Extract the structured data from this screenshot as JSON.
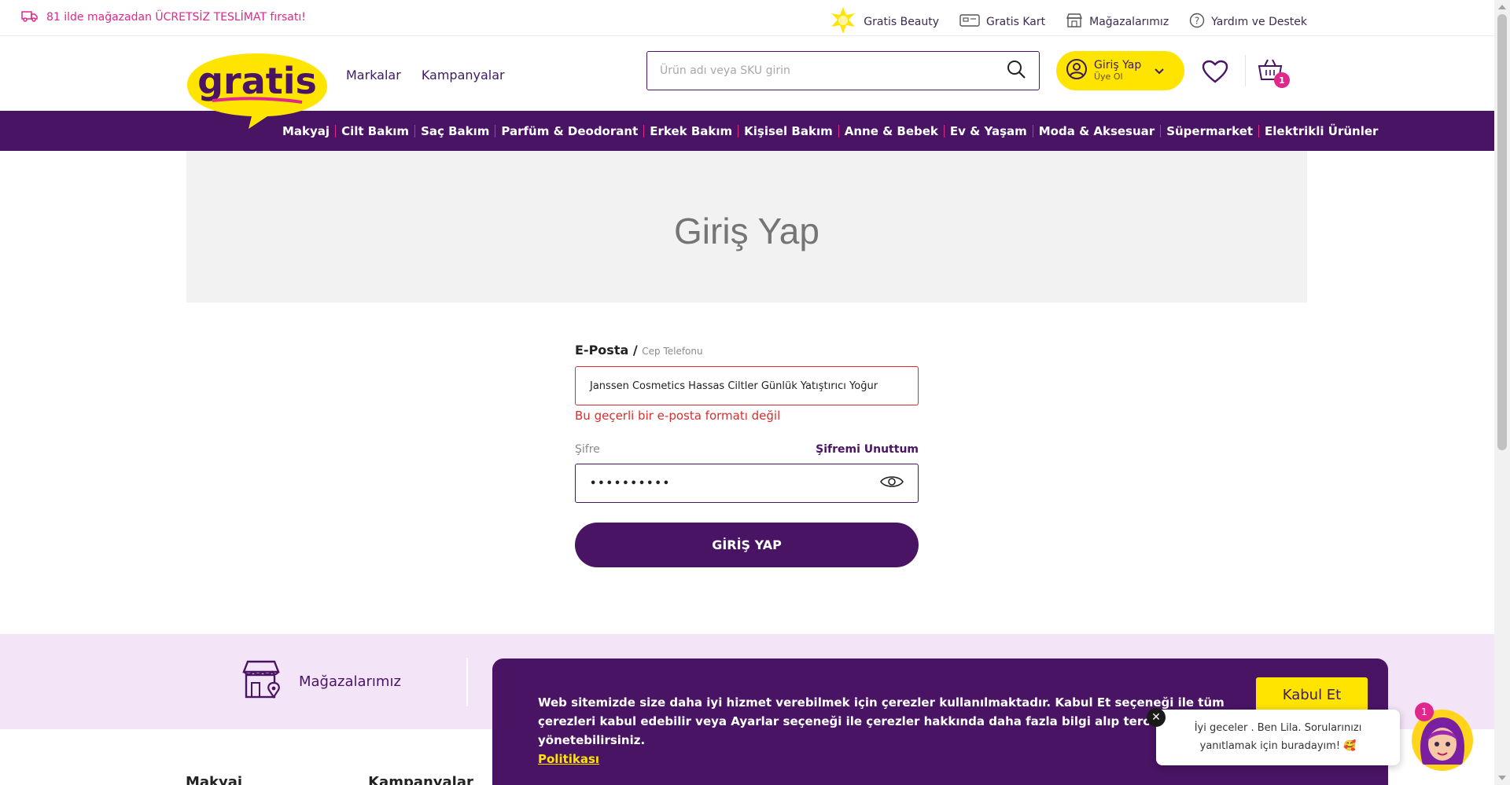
{
  "topbar": {
    "promo": "81 ilde mağazadan ÜCRETSİZ TESLİMAT fırsatı!",
    "links": [
      "Gratis Beauty",
      "Gratis Kart",
      "Mağazalarımız",
      "Yardım ve Destek"
    ]
  },
  "header": {
    "logo_text": "gratis",
    "nav": [
      "Markalar",
      "Kampanyalar"
    ],
    "search_placeholder": "Ürün adı veya SKU girin",
    "login_title": "Giriş Yap",
    "login_sub": "Üye Ol",
    "cart_count": "1"
  },
  "categories": [
    "Makyaj",
    "Cilt Bakım",
    "Saç Bakım",
    "Parfüm & Deodorant",
    "Erkek Bakım",
    "Kişisel Bakım",
    "Anne & Bebek",
    "Ev & Yaşam",
    "Moda & Aksesuar",
    "Süpermarket",
    "Elektrikli Ürünler"
  ],
  "page": {
    "title": "Giriş Yap"
  },
  "form": {
    "email_label": "E-Posta /",
    "email_sub": "Cep Telefonu",
    "email_value": "Janssen Cosmetics Hassas Ciltler Günlük Yatıştırıcı Yoğur",
    "email_error": "Bu geçerli bir e-posta formatı değil",
    "password_label": "Şifre",
    "forgot": "Şifremi Unuttum",
    "password_value": "••••••••••",
    "submit": "GİRİŞ YAP"
  },
  "band": {
    "stores": "Mağazalarımız"
  },
  "footer": {
    "cols": [
      "Makyaj",
      "Kampanyalar"
    ]
  },
  "cookie": {
    "text": "Web sitemizde size daha iyi hizmet verebilmek için çerezler kullanılmaktadır. Kabul Et seçeneği ile tüm çerezleri kabul edebilir veya Ayarlar seçeneği ile çerezler hakkında daha fazla bilgi alıp tercihlerinizi yönetebilirsiniz.",
    "link": "Politikası",
    "accept": "Kabul Et"
  },
  "chat": {
    "line1": "İyi geceler . Ben Lila. Sorularınızı",
    "line2": "yanıtlamak için buradayım! 🥰",
    "badge": "1",
    "close": "✕"
  },
  "colors": {
    "brand_purple": "#4a1465",
    "brand_pink": "#e0278b",
    "brand_yellow": "#ffe400",
    "error_red": "#d92d2d"
  }
}
